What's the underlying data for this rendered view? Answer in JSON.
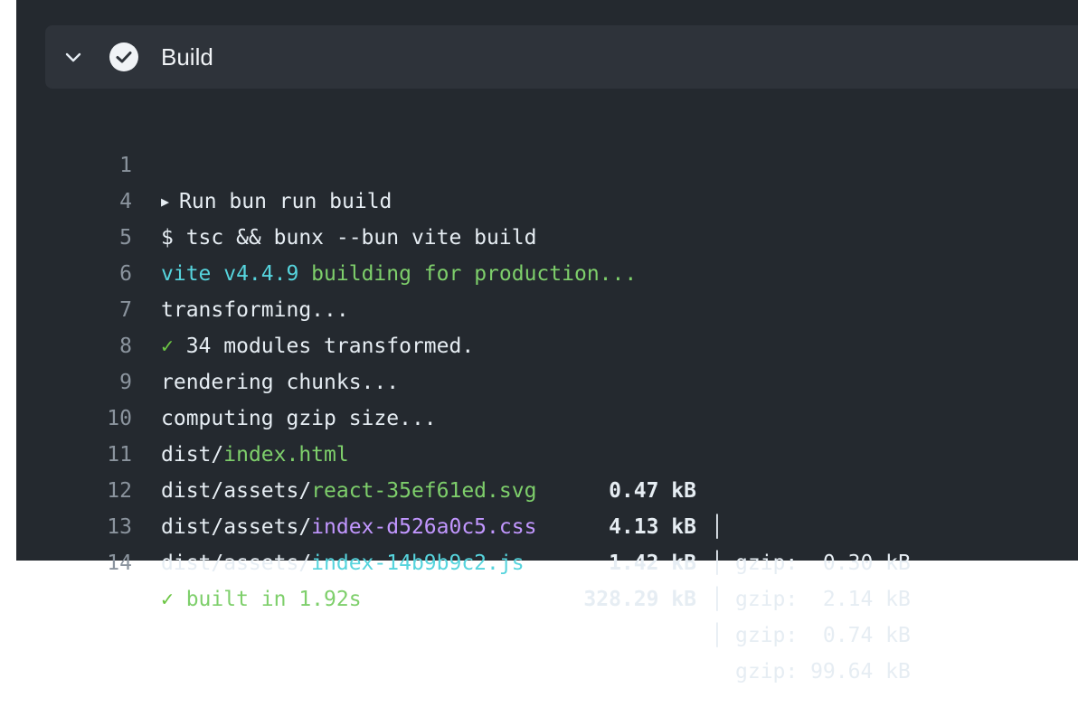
{
  "step": {
    "title": "Build",
    "status_icon": "check-circle-icon",
    "toggle_icon": "chevron-down-icon"
  },
  "colors": {
    "background": "#24292f",
    "header": "#2e333a",
    "cyan": "#56d4dd",
    "green": "#6cc644",
    "purple": "#c297ff"
  },
  "log": {
    "l1": {
      "num": "1",
      "text": "Run bun run build"
    },
    "l4": {
      "num": "4",
      "text": "$ tsc && bunx --bun vite build"
    },
    "l5": {
      "num": "5",
      "vite": "vite v4.4.9",
      "rest": " building for production..."
    },
    "l6": {
      "num": "6",
      "text": "transforming..."
    },
    "l7": {
      "num": "7",
      "check": "✓",
      "text": " 34 modules transformed."
    },
    "l8": {
      "num": "8",
      "text": "rendering chunks..."
    },
    "l9": {
      "num": "9",
      "text": "computing gzip size..."
    },
    "l10": {
      "num": "10",
      "dir": "dist/",
      "file": "index.html",
      "size": "0.47 kB",
      "bar": "│",
      "gzip": "gzip:  0.30 kB"
    },
    "l11": {
      "num": "11",
      "dir": "dist/assets/",
      "file": "react-35ef61ed.svg",
      "size": "4.13 kB",
      "bar": "│",
      "gzip": "gzip:  2.14 kB"
    },
    "l12": {
      "num": "12",
      "dir": "dist/assets/",
      "file": "index-d526a0c5.css",
      "size": "1.42 kB",
      "bar": "│",
      "gzip": "gzip:  0.74 kB"
    },
    "l13": {
      "num": "13",
      "dir": "dist/assets/",
      "file": "index-14b9b9c2.js",
      "size": "328.29 kB",
      "bar": "│",
      "gzip": "gzip: 99.64 kB"
    },
    "l14": {
      "num": "14",
      "check": "✓",
      "text": " built in 1.92s"
    }
  }
}
